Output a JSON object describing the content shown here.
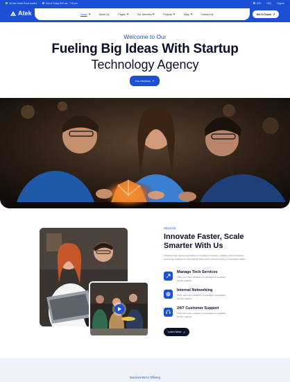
{
  "topbar": {
    "address": "65 New Dubai Road, Austria",
    "hours": "Sun to Friday 8:00 am - 7:30 pm",
    "currency": "USD",
    "faq": "FAQ",
    "support": "Support"
  },
  "header": {
    "logo_text": "Atek",
    "nav": [
      {
        "label": "Home"
      },
      {
        "label": "About Us"
      },
      {
        "label": "Pages"
      },
      {
        "label": "Our Services"
      },
      {
        "label": "Projects"
      },
      {
        "label": "Blog"
      },
      {
        "label": "Contact Us"
      }
    ],
    "cta": "Get In Touch"
  },
  "hero": {
    "subtitle": "Welcome to Our",
    "title_line1": "Fueling Big Ideas With Startup",
    "title_line2": "Technology Agency",
    "button": "Our Services"
  },
  "about": {
    "label": "About Us",
    "title": "Innovate Faster, Scale Smarter With Us",
    "description": "A Startup Tech Agency specializes in providing innovative, scalable, and customized technology solutions to help startups build, grow, and succeed in a competitive market.",
    "features": [
      {
        "title": "Manage Tech Services",
        "desc": "There are many variations of passages of available but the majority."
      },
      {
        "title": "Internal Networking",
        "desc": "There are many variations of passages of available but the majority."
      },
      {
        "title": "24/7 Customer Support",
        "desc": "There are many variations of passages of available but the majority."
      }
    ],
    "button": "Learn More"
  },
  "services": {
    "label": "Services We're Offering"
  },
  "colors": {
    "brand": "#1a4fd6",
    "dark": "#0b0f2a"
  }
}
